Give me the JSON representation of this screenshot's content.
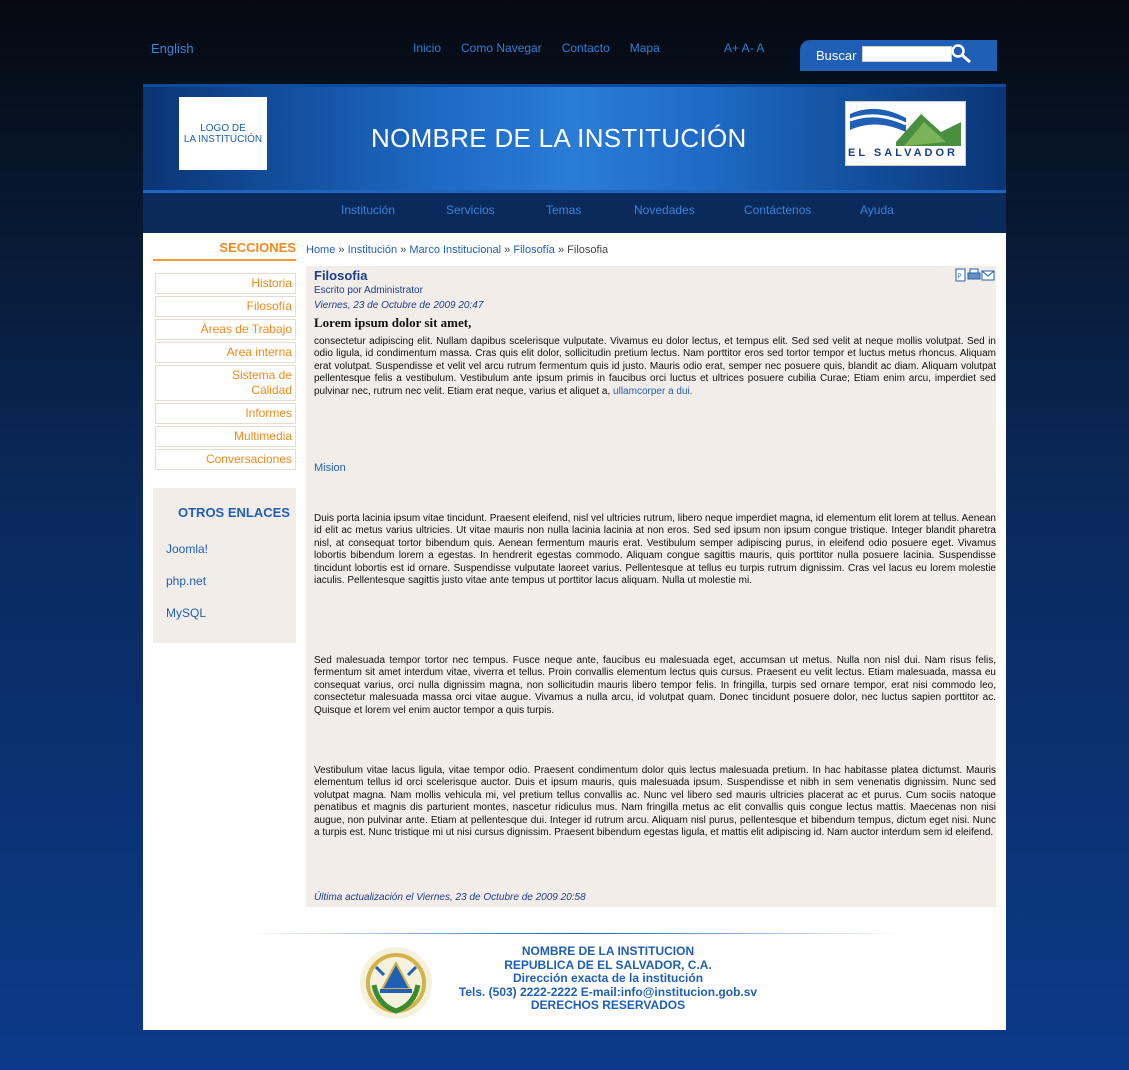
{
  "topbar": {
    "language": "English",
    "nav": [
      "Inicio",
      "Como Navegar",
      "Contacto",
      "Mapa"
    ],
    "font_size": "A+ A- A",
    "search_label": "Buscar",
    "search_value": ""
  },
  "banner": {
    "logo_text": "LOGO DE\nLA INSTITUCIÓN",
    "institution_name": "NOMBRE DE LA INSTITUCIÓN",
    "country_logo_text": "EL SALVADOR"
  },
  "main_nav": [
    "Institución",
    "Servicios",
    "Temas",
    "Novedades",
    "Contáctenos",
    "Ayuda"
  ],
  "sidebar": {
    "title": "SECCIONES",
    "items": [
      "Historia",
      "Filosofía",
      "Áreas de Trabajo",
      "Area interna",
      "Sistema de Calidad",
      "Informes",
      "Multimedia",
      "Conversaciones"
    ],
    "otros_title": "OTROS ENLACES",
    "otros_links": [
      "Joomla!",
      "php.net",
      "MySQL"
    ]
  },
  "breadcrumb": {
    "items": [
      "Home",
      "Institución",
      "Marco Institucional",
      "Filosofía"
    ],
    "separator": "»",
    "current": "Filosofia"
  },
  "article": {
    "title": "Filosofia",
    "author": "Escrito por Administrator",
    "date": "Viernes, 23 de Octubre de 2009 20:47",
    "lead": "Lorem ipsum dolor sit amet,",
    "p1": "consectetur adipiscing elit. Nullam dapibus scelerisque vulputate. Vivamus eu dolor lectus, et tempus elit. Sed sed velit at neque mollis volutpat. Sed in odio ligula, id condimentum massa. Cras quis elit dolor, sollicitudin pretium lectus. Nam porttitor eros sed tortor tempor et luctus metus rhoncus. Aliquam erat volutpat. Suspendisse et velit vel arcu rutrum fermentum quis id justo. Mauris odio erat, semper nec posuere quis, blandit ac diam. Aliquam volutpat pellentesque felis a vestibulum. Vestibulum ante ipsum primis in faucibus orci luctus et ultrices posuere cubilia Curae; Etiam enim arcu, imperdiet sed pulvinar nec, rutrum nec velit. Etiam erat neque, varius et aliquet a, ",
    "p1_link": "ullamcorper a dui.",
    "mision": "Mision",
    "p2": "Duis porta lacinia ipsum vitae tincidunt. Praesent eleifend, nisl vel ultricies rutrum, libero neque imperdiet magna, id elementum elit lorem at tellus. Aenean id elit ac metus varius ultricies. Ut vitae mauris non nulla lacinia lacinia at non eros. Sed sed ipsum non ipsum congue tristique. Integer blandit pharetra nisl, at consequat tortor bibendum quis. Aenean fermentum mauris erat. Vestibulum semper adipiscing purus, in eleifend odio posuere eget. Vivamus lobortis bibendum lorem a egestas. In hendrerit egestas commodo. Aliquam congue sagittis mauris, quis porttitor nulla posuere lacinia. Suspendisse tincidunt lobortis est id ornare. Suspendisse vulputate laoreet varius. Pellentesque at tellus eu turpis rutrum dignissim. Cras vel lacus eu lorem molestie iaculis. Pellentesque sagittis justo vitae ante tempus ut porttitor lacus aliquam. Nulla ut molestie mi.",
    "p3": "Sed malesuada tempor tortor nec tempus. Fusce neque ante, faucibus eu malesuada eget, accumsan ut metus. Nulla non nisl dui. Nam risus felis, fermentum sit amet interdum vitae, viverra et tellus. Proin convallis elementum lectus quis cursus. Praesent eu velit lectus. Etiam malesuada, massa eu consequat varius, orci nulla dignissim magna, non sollicitudin mauris libero tempor felis. In fringilla, turpis sed ornare tempor, erat nisi commodo leo, consectetur malesuada massa orci vitae augue. Vivamus a nulla arcu, id volutpat quam. Donec tincidunt posuere dolor, nec luctus sapien porttitor ac. Quisque et lorem vel enim auctor tempor a quis turpis.",
    "p4": "Vestibulum vitae lacus ligula, vitae tempor odio. Praesent condimentum dolor quis lectus malesuada pretium. In hac habitasse platea dictumst. Mauris elementum tellus id orci scelerisque auctor. Duis et ipsum mauris, quis malesuada ipsum. Suspendisse et nibh in sem venenatis dignissim. Nunc sed volutpat magna. Nam mollis vehicula mi, vel pretium tellus convallis ac. Nunc vel libero sed mauris ultricies placerat ac et purus. Cum sociis natoque penatibus et magnis dis parturient montes, nascetur ridiculus mus. Nam fringilla metus ac elit convallis quis congue lectus mattis. Maecenas non nisi augue, non pulvinar ante. Etiam at pellentesque dui. Integer id rutrum arcu. Aliquam nisl purus, pellentesque et bibendum tempus, dictum eget nisi. Nunc a turpis est. Nunc tristique mi ut nisi cursus dignissim. Praesent bibendum egestas ligula, et mattis elit adipiscing id. Nam auctor interdum sem id eleifend.",
    "updated": "Última actualización el Viernes, 23 de Octubre de 2009 20:58"
  },
  "footer": {
    "line1": "NOMBRE DE LA INSTITUCION",
    "line2": "REPUBLICA DE EL SALVADOR, C.A.",
    "line3": "Dirección exacta de la institución",
    "line4": "Tels. (503) 2222-2222 E-mail:info@institucion.gob.sv",
    "line5": "DERECHOS RESERVADOS"
  },
  "icons": [
    "pdf-icon",
    "print-icon",
    "email-icon",
    "search-icon",
    "coat-of-arms-icon"
  ],
  "colors": {
    "link_blue": "#1f5fb5",
    "orange": "#f08a1a",
    "navy": "#0b2a5c",
    "article_bg": "#f2ede8"
  }
}
